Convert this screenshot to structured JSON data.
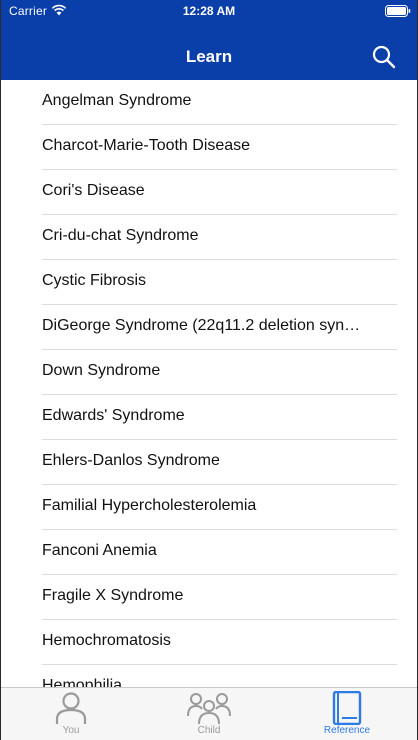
{
  "status_bar": {
    "carrier": "Carrier",
    "time": "12:28 AM"
  },
  "header": {
    "title": "Learn"
  },
  "colors": {
    "header_bg": "#0a3ea8",
    "tab_active": "#2f7be6",
    "tab_inactive": "#9a9a9a"
  },
  "list": {
    "items": [
      {
        "label": "Angelman Syndrome"
      },
      {
        "label": "Charcot-Marie-Tooth Disease"
      },
      {
        "label": "Cori's Disease"
      },
      {
        "label": "Cri-du-chat Syndrome"
      },
      {
        "label": "Cystic Fibrosis"
      },
      {
        "label": "DiGeorge Syndrome (22q11.2 deletion syn…"
      },
      {
        "label": "Down Syndrome"
      },
      {
        "label": "Edwards' Syndrome"
      },
      {
        "label": "Ehlers-Danlos Syndrome"
      },
      {
        "label": "Familial Hypercholesterolemia"
      },
      {
        "label": "Fanconi Anemia"
      },
      {
        "label": "Fragile X Syndrome"
      },
      {
        "label": "Hemochromatosis"
      },
      {
        "label": "Hemophilia"
      }
    ]
  },
  "tabbar": {
    "tabs": [
      {
        "label": "You",
        "icon": "person-icon",
        "active": false
      },
      {
        "label": "Child",
        "icon": "group-icon",
        "active": false
      },
      {
        "label": "Reference",
        "icon": "book-icon",
        "active": true
      }
    ]
  }
}
